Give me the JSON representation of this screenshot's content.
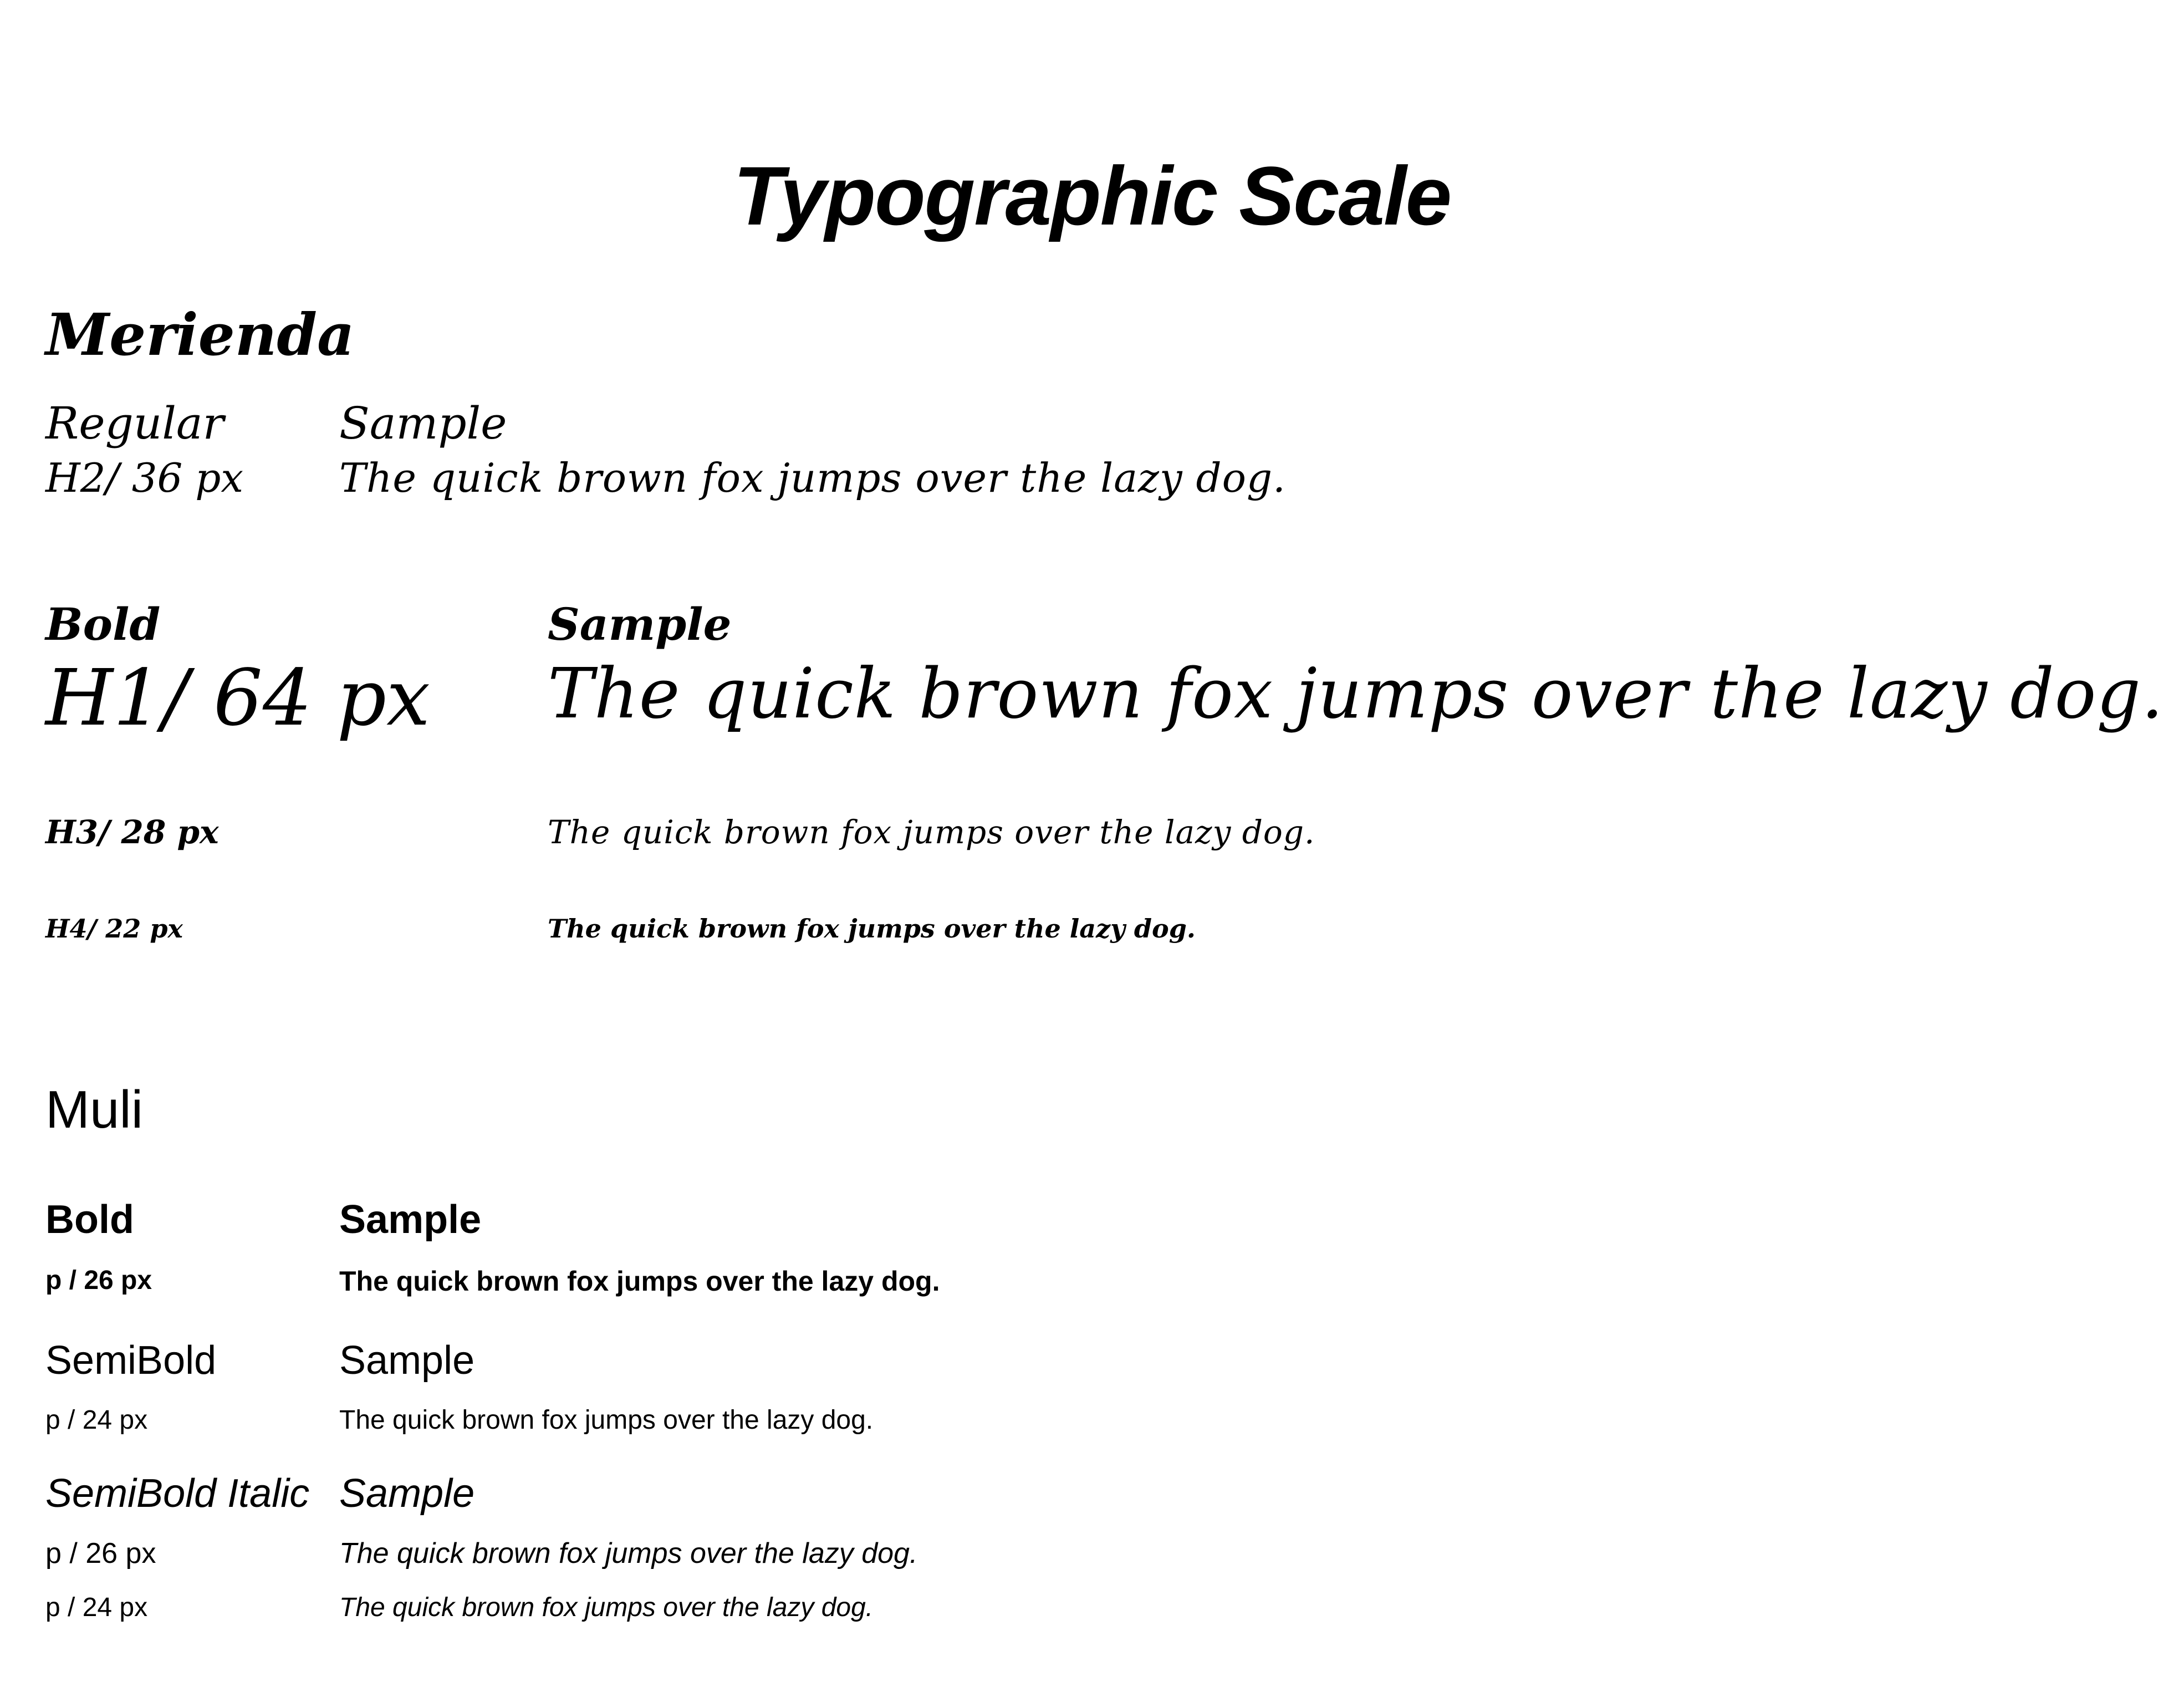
{
  "title": "Typographic Scale",
  "merienda": {
    "family_name": "Merienda",
    "regular": {
      "weight_label": "Regular",
      "sample_label": "Sample",
      "size_label": "H2/ 36 px",
      "sample_text": "The quick brown fox jumps over the lazy dog."
    },
    "bold": {
      "weight_label": "Bold",
      "sample_label": "Sample",
      "h1_label": "H1/ 64 px",
      "h1_text": "The quick brown fox jumps over the lazy dog.",
      "h3_label": "H3/ 28 px",
      "h3_text": "The quick brown fox jumps over the lazy dog.",
      "h4_label": "H4/ 22 px",
      "h4_text": "The quick brown fox jumps over the lazy dog."
    }
  },
  "muli": {
    "family_name": "Muli",
    "bold": {
      "weight_label": "Bold",
      "sample_label": "Sample",
      "size_label": "p / 26 px",
      "sample_text": "The quick brown fox jumps over the lazy dog."
    },
    "semibold": {
      "weight_label": "SemiBold",
      "sample_label": "Sample",
      "size_label": "p / 24 px",
      "sample_text": "The quick brown fox jumps over the lazy dog."
    },
    "semibold_italic": {
      "weight_label": "SemiBold Italic",
      "sample_label": "Sample",
      "size_label_1": "p / 26 px",
      "sample_text_1": "The quick brown fox jumps over the lazy dog.",
      "size_label_2": "p / 24 px",
      "sample_text_2": "The quick brown fox jumps over the lazy dog."
    }
  }
}
